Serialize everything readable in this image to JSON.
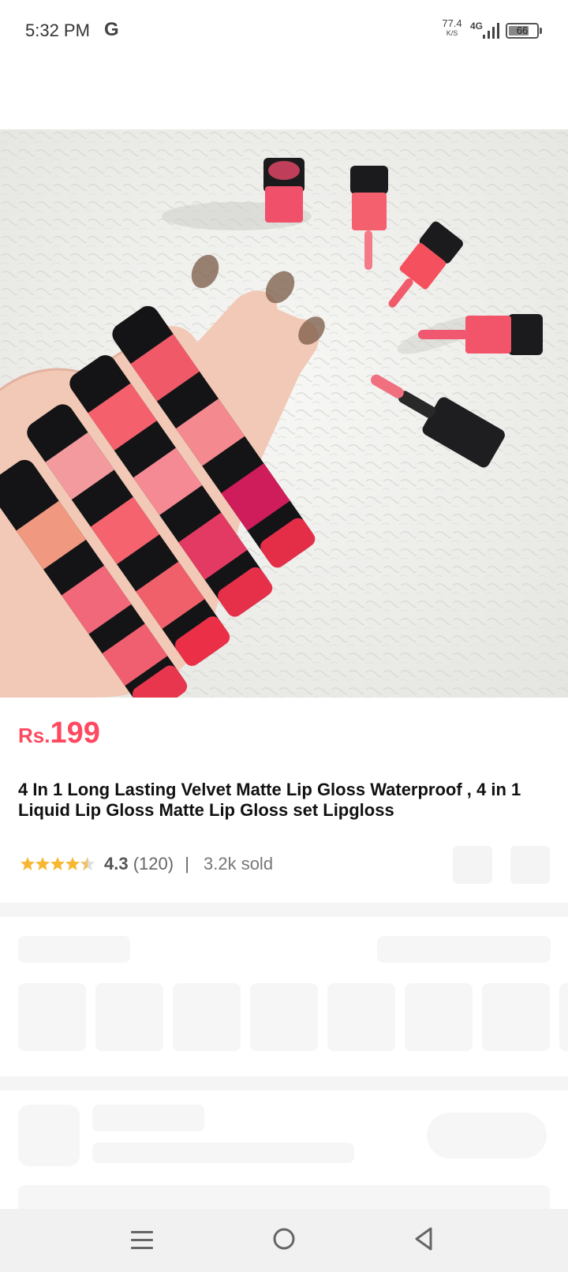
{
  "status_bar": {
    "time": "5:32 PM",
    "g_label": "G",
    "speed_value": "77.4",
    "speed_unit": "K/S",
    "network": "4G",
    "battery": "66"
  },
  "product": {
    "image_icon": "product-photo-lipgloss",
    "currency": "Rs.",
    "price": "199",
    "title": "4 In 1 Long Lasting Velvet Matte Lip Gloss Waterproof , 4 in 1 Liquid Lip Gloss Matte Lip Gloss set Lipgloss",
    "rating": "4.3",
    "rating_count": "(120)",
    "separator": "|",
    "sold": "3.2k sold",
    "stars_filled": 4.3,
    "accent_color": "#fe4960"
  },
  "nav": {
    "menu_icon": "menu-icon",
    "home_icon": "home-circle-icon",
    "back_icon": "back-triangle-icon"
  }
}
